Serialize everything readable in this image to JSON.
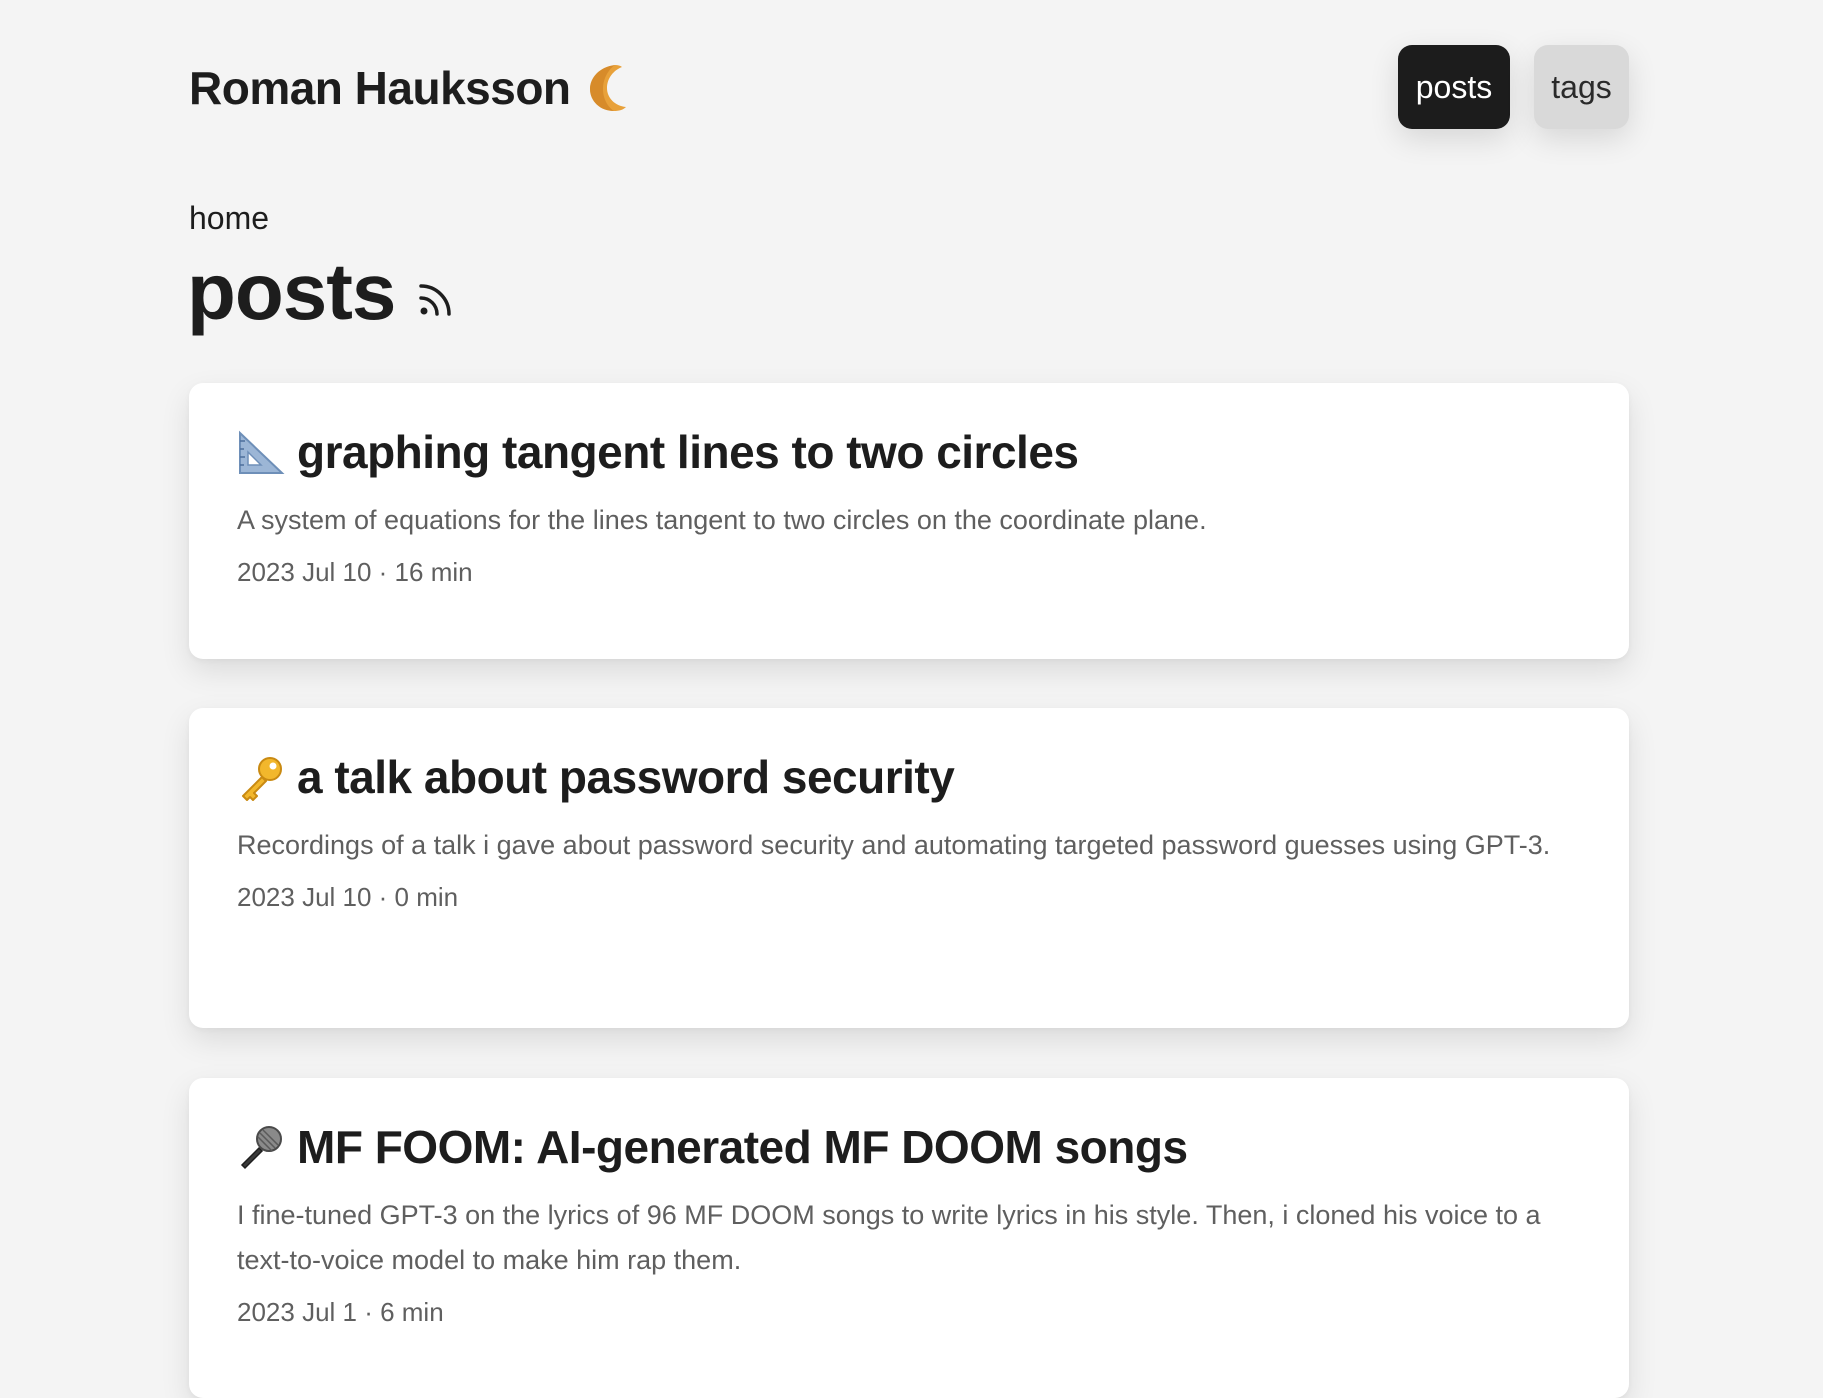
{
  "site": {
    "title": "Roman Hauksson",
    "theme_icon": "crescent-moon-icon"
  },
  "nav": {
    "items": [
      {
        "label": "posts",
        "active": true
      },
      {
        "label": "tags",
        "active": false
      }
    ]
  },
  "breadcrumb": "home",
  "page": {
    "title": "posts",
    "feed_icon": "rss-icon"
  },
  "posts": [
    {
      "icon": "triangular-ruler-icon",
      "title": "graphing tangent lines to two circles",
      "description": "A system of equations for the lines tangent to two circles on the coordinate plane.",
      "meta": "2023 Jul 10 · 16 min"
    },
    {
      "icon": "key-icon",
      "title": "a talk about password security",
      "description": "Recordings of a talk i gave about password security and automating targeted password guesses using GPT-3.",
      "meta": "2023 Jul 10 · 0 min"
    },
    {
      "icon": "microphone-icon",
      "title": "MF FOOM: AI-generated MF DOOM songs",
      "description": "I fine-tuned GPT-3 on the lyrics of 96 MF DOOM songs to write lyrics in his style. Then, i cloned his voice to a text-to-voice model to make him rap them.",
      "meta": "2023 Jul 1 · 6 min"
    }
  ],
  "colors": {
    "background": "#f4f4f4",
    "card": "#ffffff",
    "active_nav": "#1c1c1c",
    "inactive_nav": "#d9d9d9",
    "text": "#1d1d1d",
    "muted_text": "#5f5f5f",
    "moon": "#e8a13a"
  }
}
